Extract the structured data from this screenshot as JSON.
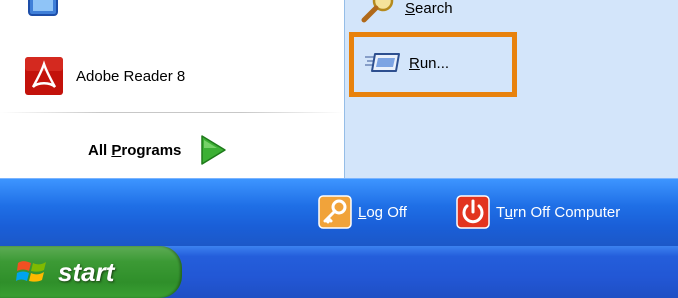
{
  "menu": {
    "left": {
      "adobe_reader": {
        "label": "Adobe Reader 8"
      },
      "all_programs": {
        "label_before": "All ",
        "label_underline": "P",
        "label_after": "rograms"
      }
    },
    "right": {
      "search": {
        "label_underline": "S",
        "label_after": "earch"
      },
      "run": {
        "label_underline": "R",
        "label_after": "un..."
      }
    }
  },
  "footer": {
    "log_off": {
      "label_underline": "L",
      "label_after": "og Off"
    },
    "turn_off": {
      "label_before": "T",
      "label_underline": "u",
      "label_after": "rn Off Computer"
    }
  },
  "taskbar": {
    "start_label": "start"
  },
  "colors": {
    "highlight_border": "#e8820c",
    "right_pane_bg": "#d3e5fa",
    "footer_bg": "#1f6fe6",
    "start_green": "#3c9a35"
  }
}
